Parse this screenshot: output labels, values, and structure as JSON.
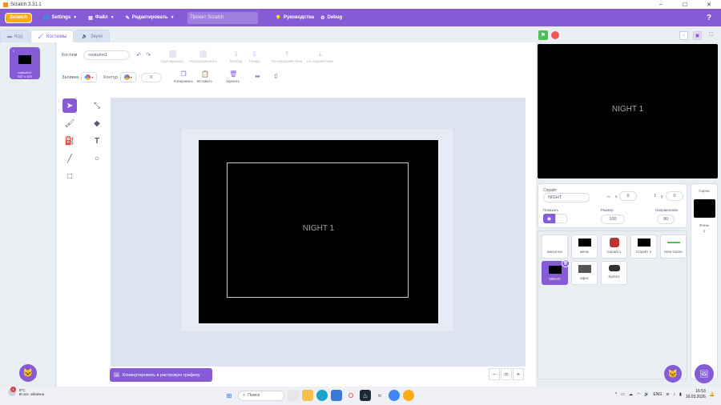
{
  "window": {
    "title": "Scratch 3.31.1",
    "controls": [
      "–",
      "☐",
      "✕"
    ]
  },
  "menubar": {
    "logo": "Scratch",
    "items": [
      {
        "label": "Settings",
        "icon": "globe-icon"
      },
      {
        "label": "Файл",
        "icon": "file-icon"
      },
      {
        "label": "Редактировать",
        "icon": "edit-icon"
      }
    ],
    "project_title": "Проект Scratch",
    "tutorials": "Руководства",
    "debug": "Debug",
    "help": "?"
  },
  "tabs": {
    "code": "Код",
    "costumes": "Костюмы",
    "sounds": "Звуки"
  },
  "costume_list": {
    "items": [
      {
        "index": "1",
        "name": "costume1",
        "size": "537 x 409"
      }
    ]
  },
  "editor": {
    "costume_label": "Костюм",
    "costume_name": "costume1",
    "group": "Группировать",
    "ungroup": "Разгруппировать",
    "forward": "Вперед",
    "backward": "Назад",
    "front": "На передний план",
    "back": "На задний план",
    "fill_label": "Заливка",
    "outline_label": "Контур",
    "outline_width": "0",
    "copy": "Копировать",
    "paste": "Вставить",
    "delete": "Удалить",
    "canvas_text": "NIGHT 1",
    "convert_button": "Конвертировать в растровую графику",
    "zoom": {
      "out": "−",
      "reset": "=",
      "in": "+"
    }
  },
  "stage": {
    "text": "NIGHT 1"
  },
  "sprite_info": {
    "sprite_label": "Спрайт",
    "sprite_name": "NIGHT",
    "x_label": "x",
    "x_value": "0",
    "y_label": "y",
    "y_value": "0",
    "show_label": "Показать",
    "size_label": "Размер",
    "size_value": "100",
    "direction_label": "Направление",
    "direction_value": "90"
  },
  "sprites": [
    {
      "name": "виньетка",
      "thumb": "blank"
    },
    {
      "name": "меню",
      "thumb": "black"
    },
    {
      "name": "Спрайт1",
      "thumb": "robot"
    },
    {
      "name": "Спрайт 2",
      "thumb": "black"
    },
    {
      "name": "New Game",
      "thumb": "green-line"
    },
    {
      "name": "NIGHT",
      "thumb": "black",
      "selected": true
    },
    {
      "name": "офис",
      "thumb": "office"
    },
    {
      "name": "Sprite1",
      "thumb": "robot2"
    }
  ],
  "stage_panel": {
    "title": "Сцена",
    "backdrops_label": "Фоны",
    "backdrops_count": "1"
  },
  "taskbar": {
    "weather_temp": "9°C",
    "weather_desc": "В осн. облачно",
    "notif_count": "1",
    "search": "Поиск",
    "lang": "ENG",
    "time": "16:53",
    "date": "16.03.2026"
  },
  "colors": {
    "accent": "#855cd6",
    "menubar": "#855cd6",
    "flag": "#4cbf56",
    "stop": "#ec5959"
  }
}
